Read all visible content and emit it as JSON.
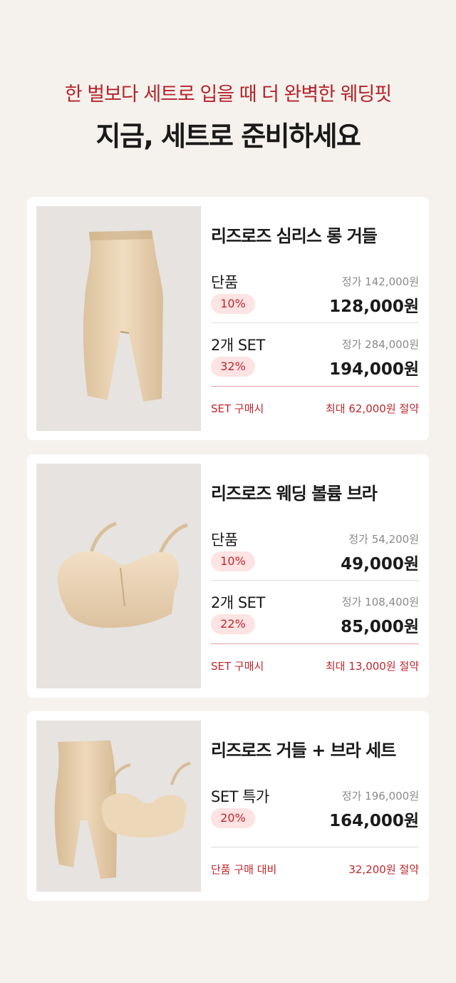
{
  "header": {
    "subtitle": "한 벌보다 세트로 입을 때 더 완벽한 웨딩핏",
    "title": "지금, 세트로 준비하세요"
  },
  "products": [
    {
      "name": "리즈로즈 심리스 롱 거들",
      "single": {
        "label": "단품",
        "badge": "10%",
        "regular": "정가 142,000원",
        "price": "128,000원"
      },
      "set": {
        "label": "2개 SET",
        "badge": "32%",
        "regular": "정가 284,000원",
        "price": "194,000원"
      },
      "footer": {
        "left": "SET 구매시",
        "right": "최대 62,000원 절약"
      }
    },
    {
      "name": "리즈로즈 웨딩 볼륨 브라",
      "single": {
        "label": "단품",
        "badge": "10%",
        "regular": "정가 54,200원",
        "price": "49,000원"
      },
      "set": {
        "label": "2개 SET",
        "badge": "22%",
        "regular": "정가 108,400원",
        "price": "85,000원"
      },
      "footer": {
        "left": "SET 구매시",
        "right": "최대 13,000원 절약"
      }
    },
    {
      "name": "리즈로즈 거들 + 브라 세트",
      "set": {
        "label": "SET 특가",
        "badge": "20%",
        "regular": "정가 196,000원",
        "price": "164,000원"
      },
      "footer": {
        "left": "단품 구매 대비",
        "right": "32,200원 절약"
      }
    }
  ],
  "colors": {
    "accent": "#b5232b",
    "badge_bg": "#fde3e3",
    "page_bg": "#f5f2ed",
    "product_beige": "#e8d2b3"
  }
}
